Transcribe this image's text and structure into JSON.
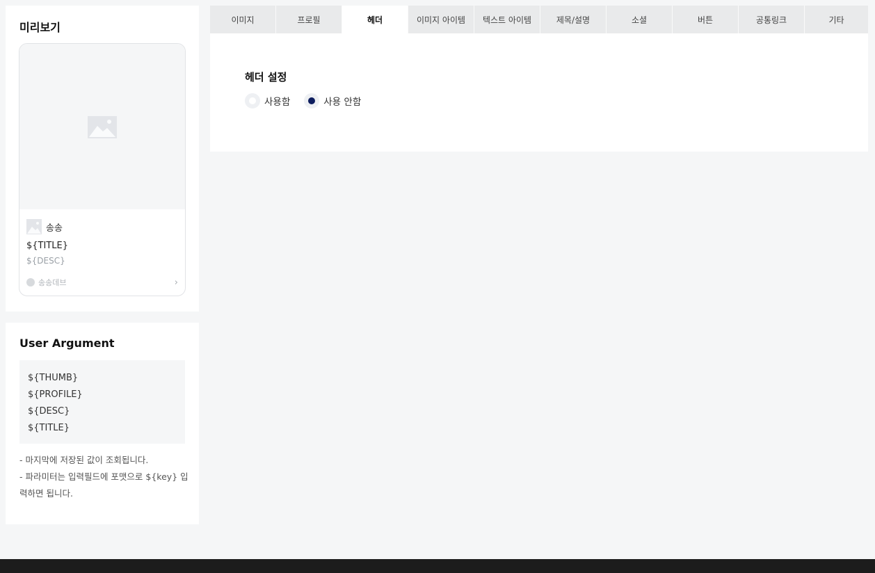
{
  "preview": {
    "title": "미리보기",
    "card": {
      "thumb_icon": "image-placeholder-icon",
      "profile_name": "송송",
      "title": "${TITLE}",
      "desc": "${DESC}",
      "footer_name": "송송데브",
      "footer_chevron": "›"
    }
  },
  "user_argument": {
    "title": "User Argument",
    "args": [
      "${THUMB}",
      "${PROFILE}",
      "${DESC}",
      "${TITLE}"
    ],
    "notes": [
      "- 마지막에 저장된 값이 조회됩니다.",
      "- 파라미터는 입력필드에 포맷으로 ${key} 입력하면 됩니다."
    ]
  },
  "tabs": [
    {
      "label": "이미지"
    },
    {
      "label": "프로필"
    },
    {
      "label": "헤더"
    },
    {
      "label": "이미지 아이템"
    },
    {
      "label": "텍스트 아이템"
    },
    {
      "label": "제목/설명"
    },
    {
      "label": "소셜"
    },
    {
      "label": "버튼"
    },
    {
      "label": "공통링크"
    },
    {
      "label": "기타"
    }
  ],
  "active_tab": "헤더",
  "header_settings": {
    "title": "헤더 설정",
    "options": [
      {
        "label": "사용함",
        "checked": false
      },
      {
        "label": "사용 안함",
        "checked": true
      }
    ]
  },
  "colors": {
    "radio_checked": "#0d1d5e",
    "tab_bg": "#e9eaeb",
    "footer_bar": "#1c1c1c"
  }
}
